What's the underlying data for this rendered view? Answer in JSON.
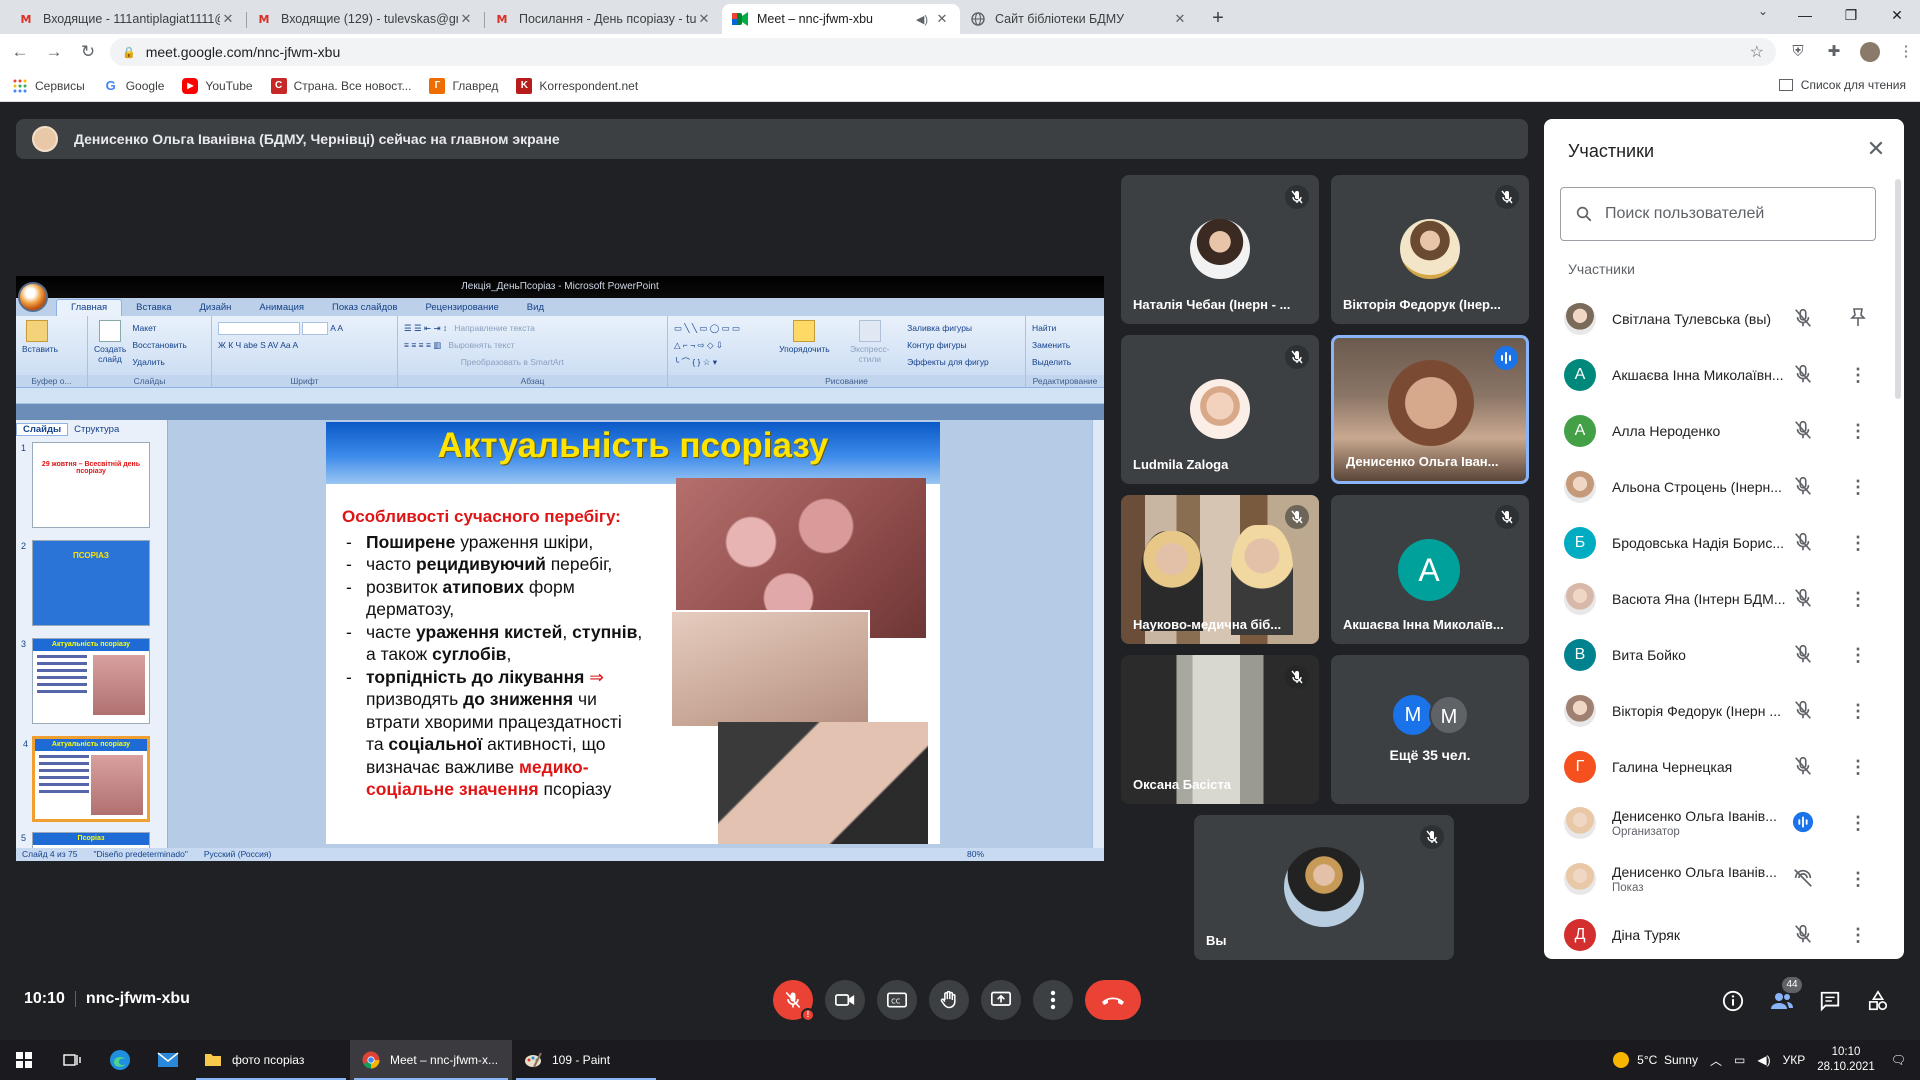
{
  "browser": {
    "tabs": [
      {
        "title": "Входящие - 111antiplagiat1111@",
        "icon": "gmail-icon",
        "active": false
      },
      {
        "title": "Входящие (129) - tulevskas@gm",
        "icon": "gmail-icon",
        "active": false
      },
      {
        "title": "Посилання - День псоріазу - tu",
        "icon": "gmail-icon",
        "active": false
      },
      {
        "title": "Meet – nnc-jfwm-xbu",
        "icon": "meet-icon",
        "active": true
      },
      {
        "title": "Сайт бібліотеки БДМУ",
        "icon": "globe-icon",
        "active": false
      }
    ],
    "url": "meet.google.com/nnc-jfwm-xbu",
    "bookmarks": [
      {
        "label": "Сервисы",
        "icon": "apps-icon",
        "color": "#ea4335"
      },
      {
        "label": "Google",
        "icon": "google-icon",
        "color": "#4285f4"
      },
      {
        "label": "YouTube",
        "icon": "youtube-icon",
        "color": "#ff0000"
      },
      {
        "label": "Страна. Все новост...",
        "icon": "strana-icon",
        "color": "#c62828"
      },
      {
        "label": "Главред",
        "icon": "glavred-icon",
        "color": "#ef6c00"
      },
      {
        "label": "Korrespondent.net",
        "icon": "korrespondent-icon",
        "color": "#b71c1c"
      }
    ],
    "reading_list": "Список для чтения"
  },
  "meet": {
    "banner": "Денисенко Ольга Іванівна (БДМУ, Чернівці) сейчас на главном экране",
    "code": "nnc-jfwm-xbu",
    "time": "10:10",
    "participants_badge": "44",
    "tiles": [
      {
        "name": "Наталія Чебан (Інерн - ...",
        "type": "photo",
        "muted": true
      },
      {
        "name": "Вікторія Федорук (Інер...",
        "type": "photo",
        "muted": true
      },
      {
        "name": "Ludmila Zaloga",
        "type": "photo",
        "muted": true
      },
      {
        "name": "Денисенко Ольга Іван...",
        "type": "video",
        "speaking": true
      },
      {
        "name": "Науково-медична біб...",
        "type": "video",
        "muted": true
      },
      {
        "name": "Акшаєва Інна Миколаїв...",
        "type": "letter",
        "letter": "А",
        "muted": true
      },
      {
        "name": "Оксана Басіста",
        "type": "video",
        "muted": true
      },
      {
        "name": "Ещё 35 чел.",
        "type": "more",
        "letters": [
          "М",
          "М"
        ]
      },
      {
        "name": "Вы",
        "type": "photo",
        "muted": true
      }
    ]
  },
  "slide": {
    "window_title": "Лекція_ДеньПсоріаз - Microsoft PowerPoint",
    "ribbon_tabs": [
      "Главная",
      "Вставка",
      "Дизайн",
      "Анимация",
      "Показ слайдов",
      "Рецензирование",
      "Вид"
    ],
    "ribbon_groups": [
      "Буфер о...",
      "Слайды",
      "Шрифт",
      "Абзац",
      "Рисование",
      "Редактирование"
    ],
    "ribbon": {
      "paste": "Вставить",
      "new_slide": "Создать слайд",
      "layout": "Макет",
      "reset": "Восстановить",
      "delete": "Удалить",
      "text_dir": "Направление текста",
      "align_text": "Выровнять текст",
      "smartart": "Преобразовать в SmartArt",
      "arrange": "Упорядочить",
      "quick_styles": "Экспресс-стили",
      "fill": "Заливка фигуры",
      "outline": "Контур фигуры",
      "effects": "Эффекты для фигур",
      "find": "Найти",
      "replace": "Заменить",
      "select": "Выделить"
    },
    "panel_tabs": [
      "Слайды",
      "Структура"
    ],
    "thumbnails": [
      {
        "num": "1",
        "label": "29 жовтня – Всесвітній день псоріазу"
      },
      {
        "num": "2",
        "label": "ПСОРІАЗ"
      },
      {
        "num": "3",
        "label": "Актуальність псоріазу"
      },
      {
        "num": "4",
        "label": "Актуальність псоріазу"
      },
      {
        "num": "5",
        "label": "Псоріаз"
      }
    ],
    "status": {
      "slide": "Слайд 4 из 75",
      "theme": "\"Diseño predeterminado\"",
      "lang": "Русский (Россия)",
      "zoom": "80%"
    },
    "title": "Актуальність псоріазу",
    "heading": "Особливості сучасного перебігу:"
  },
  "panel": {
    "title": "Участники",
    "search_placeholder": "Поиск пользователей",
    "section": "Участники",
    "people": [
      {
        "name": "Світлана Тулевська (вы)",
        "avatar": "photo",
        "color": "#7a6a5a",
        "action": "pin"
      },
      {
        "name": "Акшаєва Інна Миколаївн...",
        "avatar": "А",
        "color": "#00897b",
        "action": "more"
      },
      {
        "name": "Алла Нероденко",
        "avatar": "А",
        "color": "#43a047",
        "action": "more"
      },
      {
        "name": "Альона Строцень (Інерн...",
        "avatar": "photo",
        "color": "#c49a7a",
        "action": "more"
      },
      {
        "name": "Бродовська Надія Борис...",
        "avatar": "Б",
        "color": "#00acc1",
        "action": "more"
      },
      {
        "name": "Васюта Яна (Інтерн БДМ...",
        "avatar": "photo",
        "color": "#d8b8a8",
        "action": "more"
      },
      {
        "name": "Вита Бойко",
        "avatar": "В",
        "color": "#00838f",
        "action": "more"
      },
      {
        "name": "Вікторія Федорук (Інерн ...",
        "avatar": "photo",
        "color": "#a08070",
        "action": "more"
      },
      {
        "name": "Галина Чернецкая",
        "avatar": "Г",
        "color": "#f4511e",
        "action": "more"
      },
      {
        "name": "Денисенко Ольга Іванів...",
        "sub": "Организатор",
        "avatar": "photo",
        "color": "#e9c8a8",
        "action": "more",
        "speaking": true
      },
      {
        "name": "Денисенко Ольга Іванів...",
        "sub": "Показ",
        "avatar": "photo",
        "color": "#e9c8a8",
        "action": "more",
        "present": true
      },
      {
        "name": "Діна Туряк",
        "avatar": "Д",
        "color": "#d32f2f",
        "action": "more"
      }
    ]
  },
  "taskbar": {
    "apps": [
      {
        "label": "фото псоріаз",
        "icon": "folder-icon"
      },
      {
        "label": "Meet – nnc-jfwm-x...",
        "icon": "chrome-icon"
      },
      {
        "label": "109 - Paint",
        "icon": "paint-icon"
      }
    ],
    "weather": "5°C  Sunny",
    "lang": "УКР",
    "time": "10:10",
    "date": "28.10.2021"
  }
}
